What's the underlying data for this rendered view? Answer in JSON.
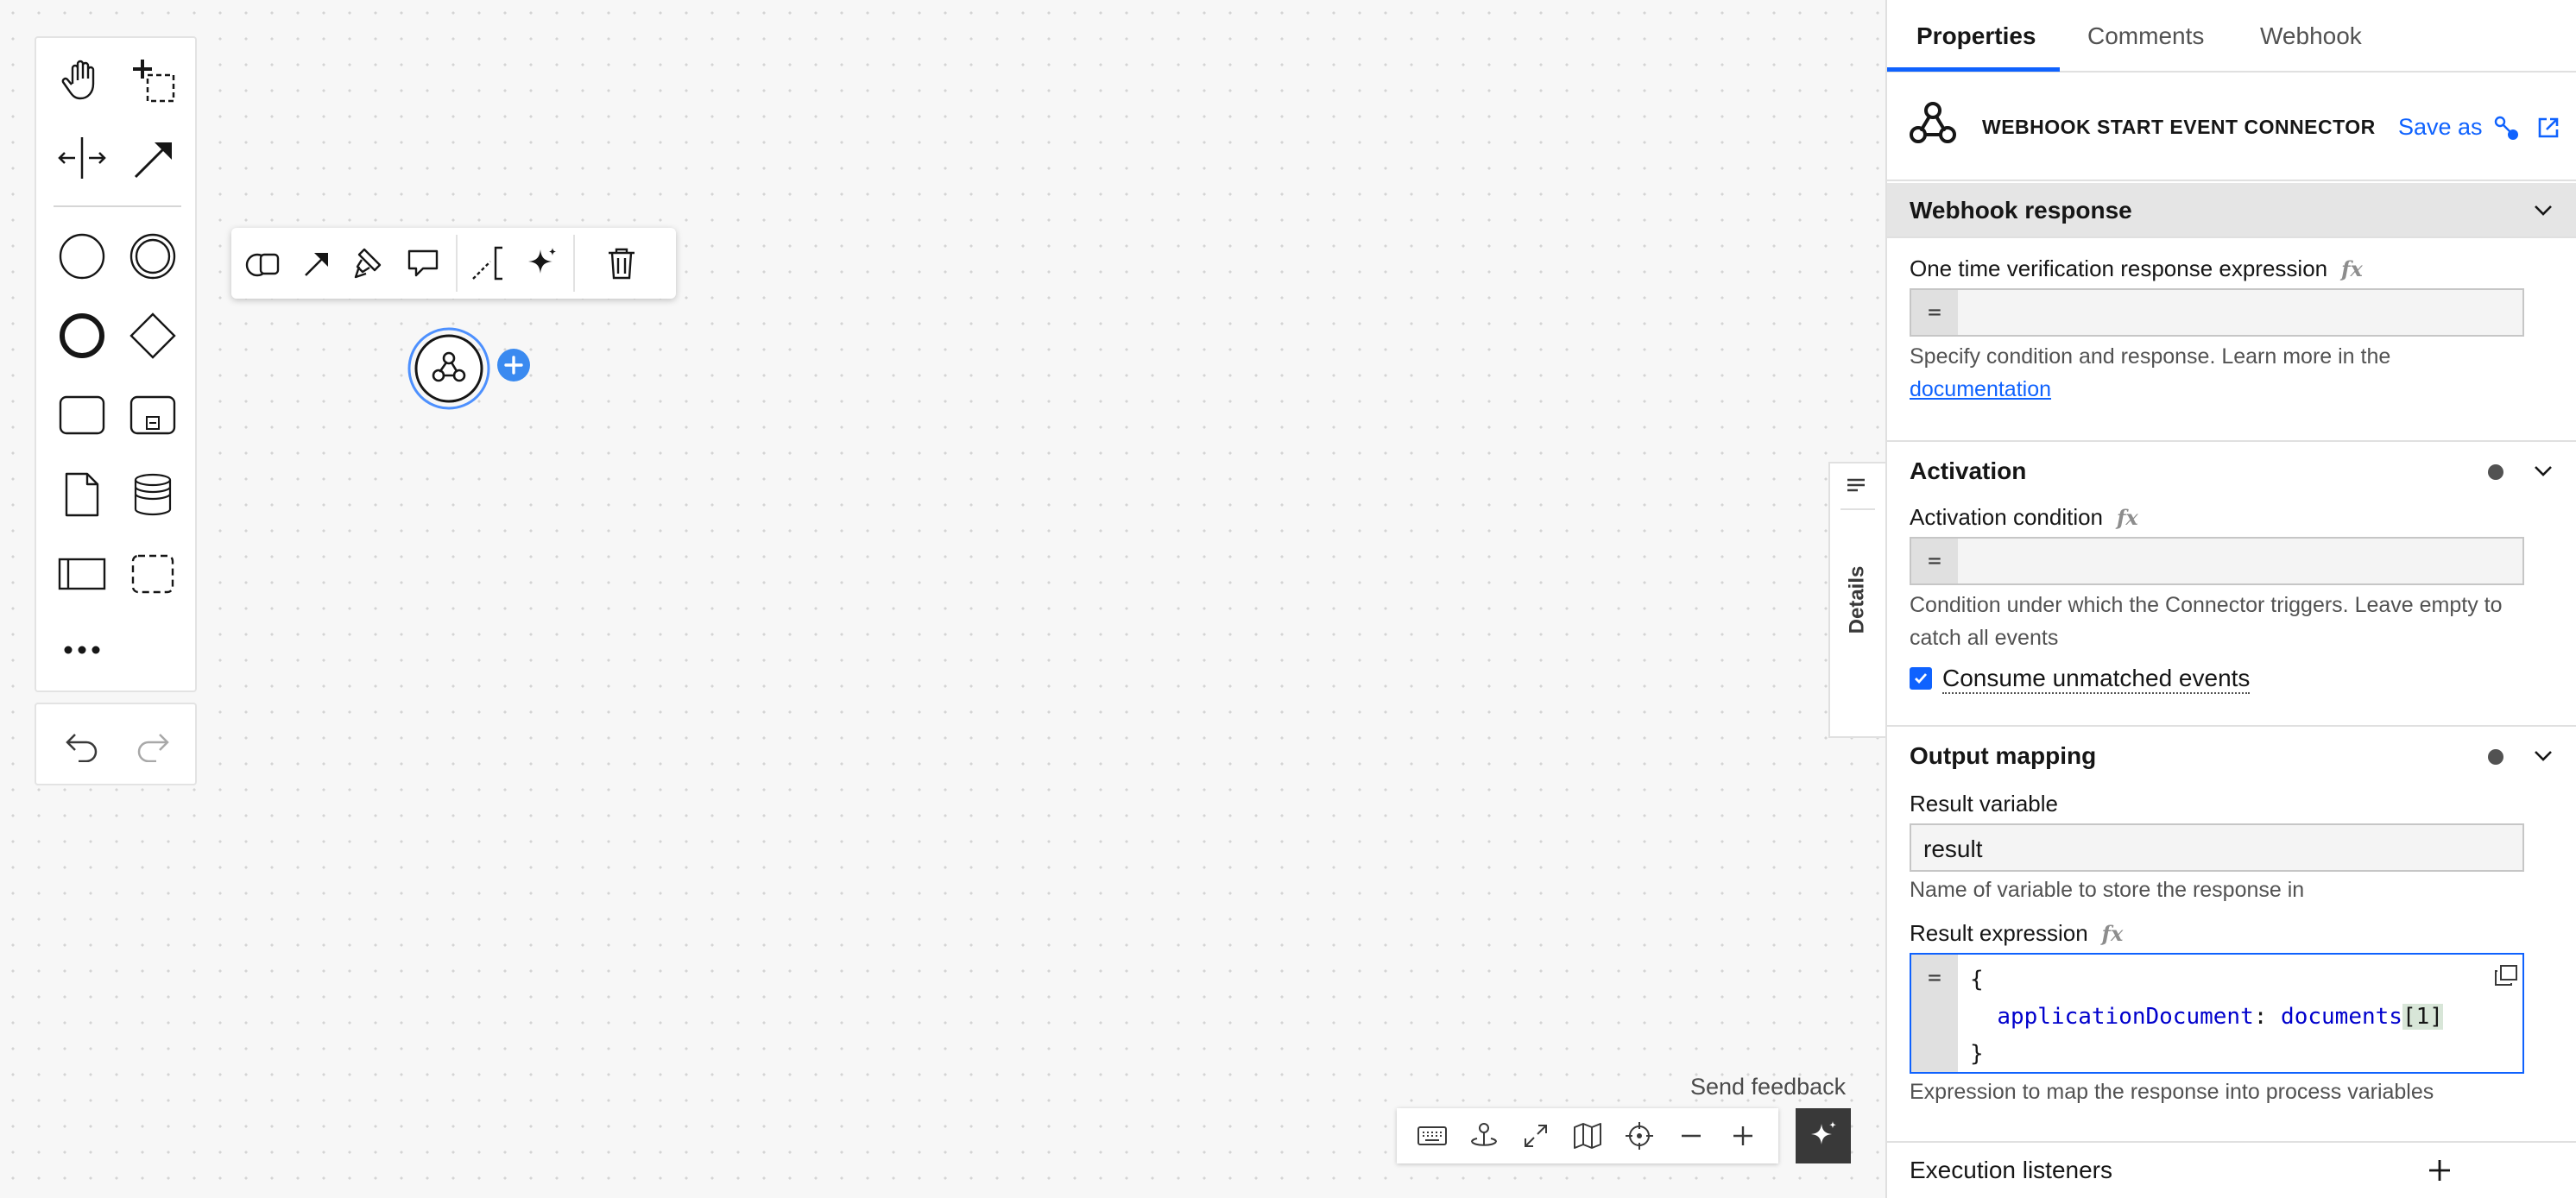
{
  "palette": {
    "tools": [
      "hand-tool",
      "lasso-tool",
      "space-tool",
      "global-connect-tool"
    ],
    "shapes": [
      "start-event",
      "intermediate-event",
      "end-event",
      "gateway",
      "task",
      "subprocess",
      "data-object",
      "data-store",
      "participant",
      "group",
      "more"
    ],
    "history": [
      "undo",
      "redo"
    ]
  },
  "context_pad": {
    "actions": [
      "change-type",
      "connect",
      "color",
      "comment",
      "text-annotation",
      "ai-assist",
      "delete"
    ]
  },
  "canvas": {
    "element": "webhook-start-event",
    "selected": true
  },
  "bottom_toolbar": {
    "send_feedback": "Send feedback",
    "actions": [
      "keyboard",
      "variables",
      "fullscreen",
      "minimap",
      "reset-view",
      "zoom-out",
      "zoom-in"
    ]
  },
  "details_toggle": {
    "label": "Details"
  },
  "properties_panel": {
    "tabs": [
      {
        "label": "Properties",
        "active": true
      },
      {
        "label": "Comments",
        "active": false
      },
      {
        "label": "Webhook",
        "active": false
      }
    ],
    "header": {
      "title": "WEBHOOK START EVENT CONNECTOR",
      "save_as": "Save as"
    },
    "webhook_response": {
      "title": "Webhook response",
      "verification_label": "One time verification response expression",
      "verification_value": "",
      "verification_help": "Specify condition and response. Learn more in the",
      "verification_link": "documentation"
    },
    "activation": {
      "title": "Activation",
      "condition_label": "Activation condition",
      "condition_value": "",
      "condition_help": "Condition under which the Connector triggers. Leave empty to catch all events",
      "consume_label": "Consume unmatched events",
      "consume_checked": true
    },
    "output_mapping": {
      "title": "Output mapping",
      "result_variable_label": "Result variable",
      "result_variable_value": "result",
      "result_variable_help": "Name of variable to store the response in",
      "result_expression_label": "Result expression",
      "result_expression": {
        "line1": "{",
        "key": "applicationDocument",
        "colon": ": ",
        "value": "documents",
        "index": "[1]",
        "line3": "}"
      },
      "result_expression_help": "Expression to map the response into process variables"
    },
    "execution_listeners": {
      "title": "Execution listeners"
    }
  },
  "colors": {
    "accent": "#0f62fe",
    "selection_ring": "#4d90fe",
    "append_button": "#3a8af0",
    "ai_button": "#393939"
  }
}
